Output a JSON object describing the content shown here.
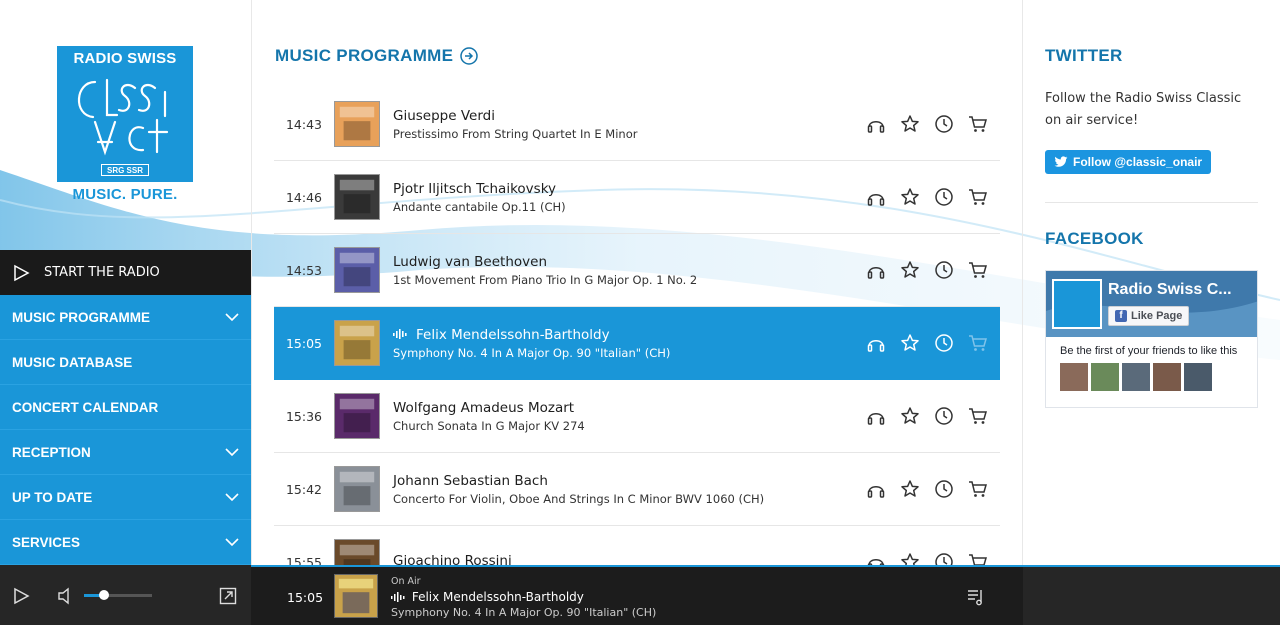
{
  "logo": {
    "top_text": "RADIO SWISS",
    "wordmark": "CLASSIC",
    "badge": "SRG SSR",
    "tagline": "MUSIC. PURE."
  },
  "nav": {
    "start_label": "START THE RADIO",
    "items": [
      {
        "label": "MUSIC PROGRAMME",
        "expandable": true
      },
      {
        "label": "MUSIC DATABASE",
        "expandable": false
      },
      {
        "label": "CONCERT CALENDAR",
        "expandable": false
      },
      {
        "label": "RECEPTION",
        "expandable": true
      },
      {
        "label": "UP TO DATE",
        "expandable": true
      },
      {
        "label": "SERVICES",
        "expandable": true
      }
    ]
  },
  "programme": {
    "title": "MUSIC PROGRAMME",
    "tracks": [
      {
        "time": "14:43",
        "composer": "Giuseppe Verdi",
        "work": "Prestissimo From String Quartet In E Minor",
        "active": false,
        "cover_color": "#e8a15a"
      },
      {
        "time": "14:46",
        "composer": "Pjotr Iljitsch Tchaikovsky",
        "work": "Andante cantabile Op.11 (CH)",
        "active": false,
        "cover_color": "#3a3a3a"
      },
      {
        "time": "14:53",
        "composer": "Ludwig van Beethoven",
        "work": "1st Movement From Piano Trio In G Major Op. 1 No. 2",
        "active": false,
        "cover_color": "#5b5ea8"
      },
      {
        "time": "15:05",
        "composer": "Felix Mendelssohn-Bartholdy",
        "work": "Symphony No. 4 In A Major Op. 90 \"Italian\" (CH)",
        "active": true,
        "cover_color": "#c9a24a"
      },
      {
        "time": "15:36",
        "composer": "Wolfgang Amadeus Mozart",
        "work": "Church Sonata In G Major KV 274",
        "active": false,
        "cover_color": "#5a2a6a"
      },
      {
        "time": "15:42",
        "composer": "Johann Sebastian Bach",
        "work": "Concerto For Violin, Oboe And Strings In C Minor BWV 1060 (CH)",
        "active": false,
        "cover_color": "#8a9098"
      },
      {
        "time": "15:55",
        "composer": "Gioachino Rossini",
        "work": "",
        "active": false,
        "cover_color": "#6a4a2a"
      }
    ]
  },
  "twitter": {
    "title": "TWITTER",
    "text": "Follow the Radio Swiss Classic on air service!",
    "button": "Follow @classic_onair"
  },
  "facebook": {
    "title": "FACEBOOK",
    "page_name": "Radio Swiss C...",
    "like_label": "Like Page",
    "friends_text": "Be the first of your friends to like this"
  },
  "player": {
    "on_air_label": "On Air",
    "time": "15:05",
    "composer": "Felix Mendelssohn-Bartholdy",
    "work": "Symphony No. 4 In A Major Op. 90 \"Italian\" (CH)",
    "volume": 0.3
  },
  "colors": {
    "accent": "#1a96d8",
    "title_blue": "#1475ab",
    "dark": "#1a1a1a"
  }
}
